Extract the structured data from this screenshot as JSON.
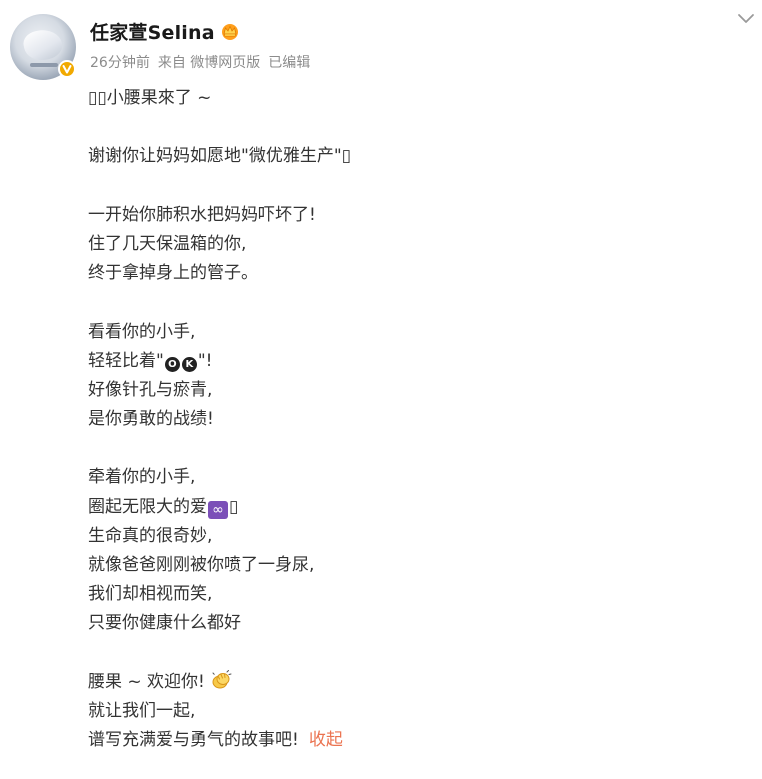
{
  "post": {
    "author": "任家萱Selina",
    "meta": {
      "time": "26分钟前",
      "source": "来自 微博网页版",
      "edited": "已编辑"
    },
    "lines": [
      "▯▯小腰果來了 ~",
      "",
      "谢谢你让妈妈如愿地\"微优雅生产\"▯",
      "",
      "一开始你肺积水把妈妈吓坏了!",
      "住了几天保温箱的你,",
      "终于拿掉身上的管子。",
      "",
      "看看你的小手,",
      "轻轻比着\"",
      "好像针孔与瘀青,",
      "是你勇敢的战绩!",
      "",
      "牵着你的小手,",
      "圈起无限大的爱",
      "生命真的很奇妙,",
      "就像爸爸刚刚被你喷了一身尿,",
      "我们却相视而笑,",
      "只要你健康什么都好",
      "",
      "腰果 ~ 欢迎你!",
      "就让我们一起,",
      "谱写充满爱与勇气的故事吧!"
    ],
    "ok_suffix": "\"!",
    "ok_glyphs": [
      "O",
      "K"
    ],
    "infinity_glyph": "∞",
    "infinity_suffix": "▯",
    "collapse_label": "收起"
  },
  "colors": {
    "link": "#eb7350",
    "meta": "#8c8c8c",
    "badge": "#f1a900"
  },
  "icons": [
    "avatar",
    "verified-badge-icon",
    "crown-icon",
    "chevron-down-icon",
    "clap-hands-icon"
  ]
}
